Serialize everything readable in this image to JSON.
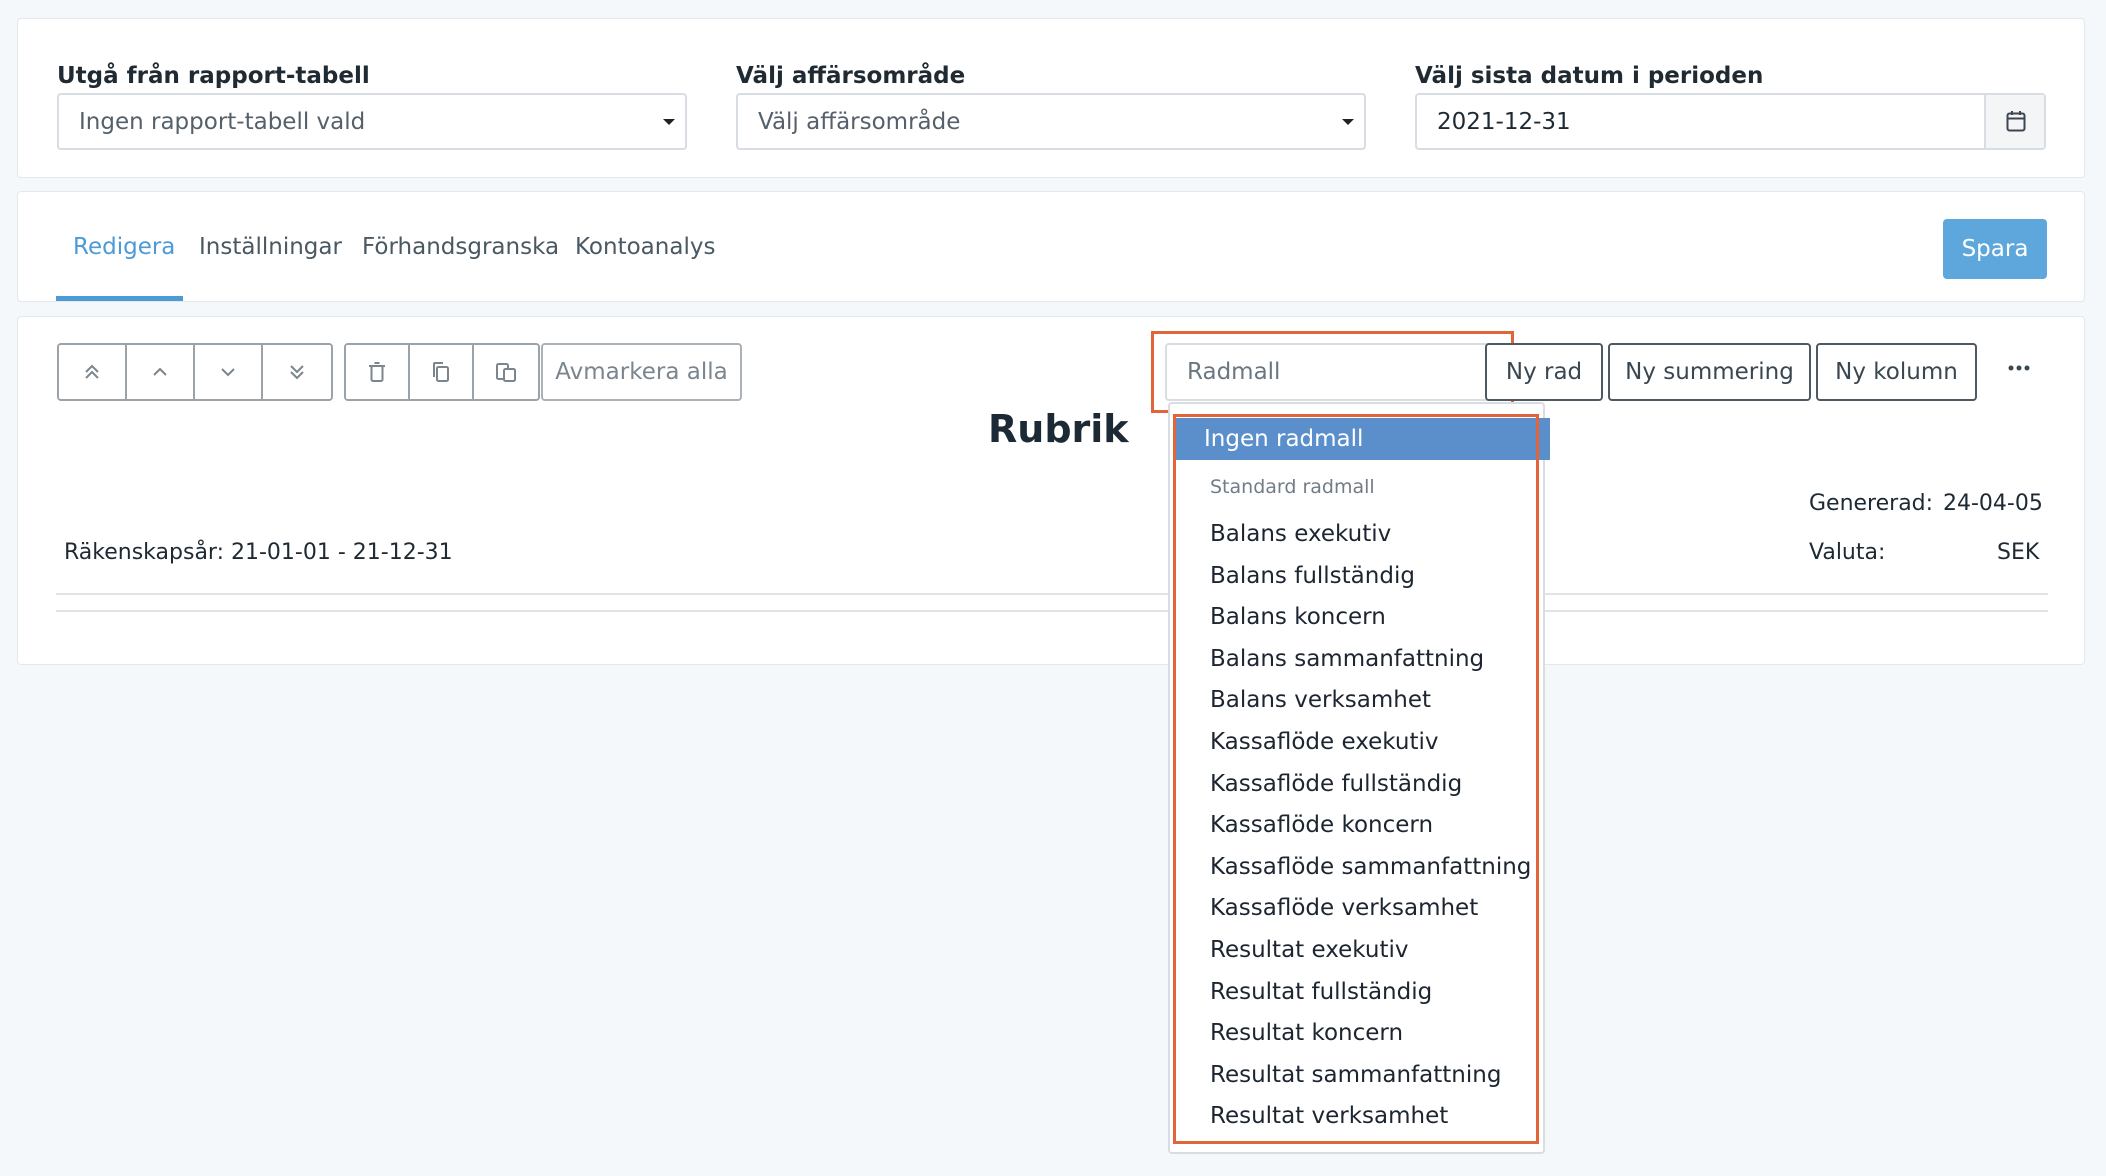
{
  "filters": {
    "report_table": {
      "label": "Utgå från rapport-tabell",
      "value": "Ingen rapport-tabell vald"
    },
    "business_area": {
      "label": "Välj affärsområde",
      "value": "Välj affärsområde"
    },
    "last_date": {
      "label": "Välj sista datum i perioden",
      "value": "2021-12-31"
    }
  },
  "tabs": [
    {
      "label": "Redigera",
      "active": true
    },
    {
      "label": "Inställningar"
    },
    {
      "label": "Förhandsgranska"
    },
    {
      "label": "Kontoanalys"
    }
  ],
  "save_label": "Spara",
  "toolbar": {
    "deselect_all": "Avmarkera alla",
    "row_template_placeholder": "Radmall",
    "new_row": "Ny rad",
    "new_sum": "Ny summering",
    "new_column": "Ny kolumn"
  },
  "document": {
    "title": "Rubrik",
    "generated_label": "Genererad:",
    "generated_value": "24-04-05",
    "currency_label": "Valuta:",
    "currency_value": "SEK",
    "fiscal_year_label": "Räkenskapsår:",
    "fiscal_year_value": "21-01-01 - 21-12-31"
  },
  "row_template_dropdown": {
    "selected": "Ingen radmall",
    "group_label": "Standard radmall",
    "items": [
      "Balans exekutiv",
      "Balans fullständig",
      "Balans koncern",
      "Balans sammanfattning",
      "Balans verksamhet",
      "Kassaflöde exekutiv",
      "Kassaflöde fullständig",
      "Kassaflöde koncern",
      "Kassaflöde sammanfattning",
      "Kassaflöde verksamhet",
      "Resultat exekutiv",
      "Resultat fullständig",
      "Resultat koncern",
      "Resultat sammanfattning",
      "Resultat verksamhet"
    ]
  },
  "colors": {
    "accent": "#5da7dd",
    "tab_active": "#4c9ad6",
    "highlight": "#e2643a",
    "selected_option": "#5a8fcc"
  }
}
